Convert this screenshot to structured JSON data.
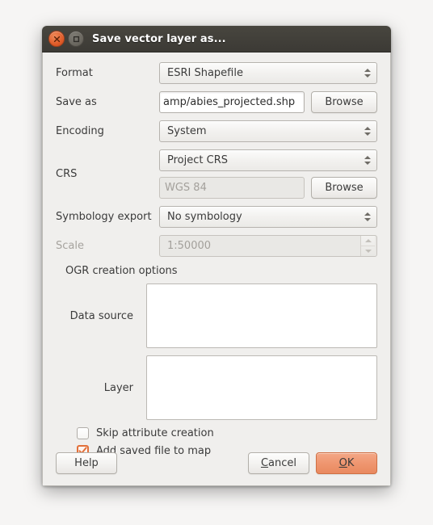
{
  "window": {
    "title": "Save vector layer as...",
    "close_icon": "close-icon",
    "maximize_icon": "maximize-icon"
  },
  "form": {
    "format": {
      "label": "Format",
      "value": "ESRI Shapefile"
    },
    "save_as": {
      "label": "Save as",
      "value": "amp/abies_projected.shp",
      "browse_label": "Browse"
    },
    "encoding": {
      "label": "Encoding",
      "value": "System"
    },
    "crs": {
      "label": "CRS",
      "value": "Project CRS",
      "detail_value": "WGS 84",
      "browse_label": "Browse"
    },
    "symbology_export": {
      "label": "Symbology export",
      "value": "No symbology"
    },
    "scale": {
      "label": "Scale",
      "value": "1:50000"
    }
  },
  "ogr": {
    "group_title": "OGR creation options",
    "data_source": {
      "label": "Data source",
      "value": ""
    },
    "layer": {
      "label": "Layer",
      "value": ""
    }
  },
  "options": {
    "skip_attribute_creation": {
      "label": "Skip attribute creation",
      "checked": false
    },
    "add_saved_file_to_map": {
      "label": "Add saved file to map",
      "checked": true
    }
  },
  "buttons": {
    "help": "Help",
    "cancel_prefix": "",
    "cancel_accel": "C",
    "cancel_suffix": "ancel",
    "ok_prefix": "",
    "ok_accel": "O",
    "ok_suffix": "K"
  },
  "colors": {
    "titlebar": "#3c3a35",
    "dialog_bg": "#f0efed",
    "accent_orange": "#e9895f",
    "close_button": "#df5b28",
    "checkbox_orange": "#e2703a"
  }
}
